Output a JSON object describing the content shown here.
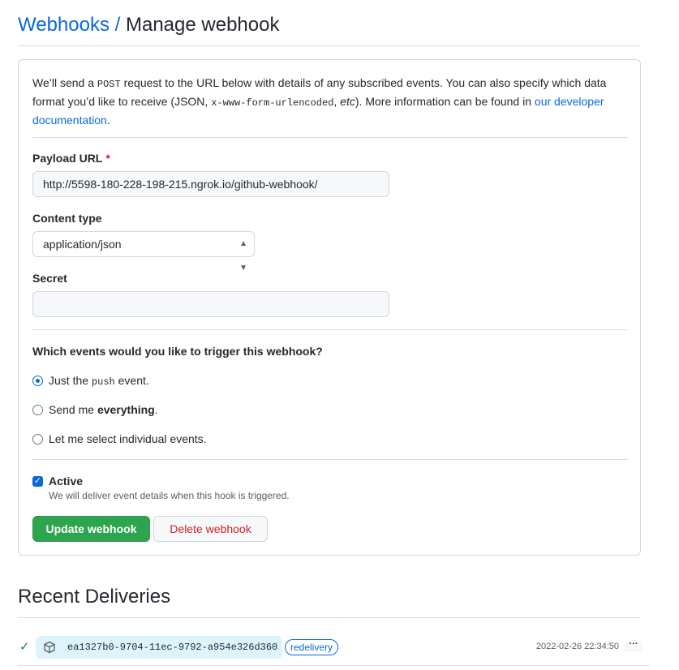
{
  "header": {
    "breadcrumb_parent": "Webhooks",
    "separator": " / ",
    "title": "Manage webhook"
  },
  "intro": {
    "text_1": "We’ll send a ",
    "method": "POST",
    "text_2": " request to the URL below with details of any subscribed events. You can also specify which data format you’d like to receive (JSON, ",
    "format_code": "x-www-form-urlencoded",
    "text_3": ", ",
    "etc": "etc",
    "text_4": "). More information can be found in ",
    "link": "our developer documentation",
    "text_5": "."
  },
  "form": {
    "payload_url_label": "Payload URL",
    "required_mark": "*",
    "payload_url_value": "http://5598-180-228-198-215.ngrok.io/github-webhook/",
    "content_type_label": "Content type",
    "content_type_value": "application/json",
    "secret_label": "Secret",
    "secret_value": "",
    "events_question": "Which events would you like to trigger this webhook?",
    "events": [
      {
        "pre": "Just the ",
        "code": "push",
        "post": " event.",
        "checked": true
      },
      {
        "pre": "Send me ",
        "bold": "everything",
        "post": ".",
        "checked": false
      },
      {
        "pre": "Let me select individual events.",
        "checked": false
      }
    ],
    "active_label": "Active",
    "active_checked": true,
    "active_note": "We will deliver event details when this hook is triggered.",
    "update_button": "Update webhook",
    "delete_button": "Delete webhook"
  },
  "recent": {
    "title": "Recent Deliveries",
    "deliveries": [
      {
        "status_icon": "check-icon",
        "type_icon": "package-icon",
        "guid": "ea1327b0-9704-11ec-9792-a954e326d360",
        "badge": "redelivery",
        "timestamp": "2022-02-26 22:34:50",
        "menu": "···"
      }
    ]
  },
  "colors": {
    "link": "#0969da",
    "required": "#cf222e",
    "primary_button": "#2da44e",
    "danger_text": "#cf222e",
    "success": "#1a7f37",
    "guid_bg": "#ddf4ff"
  }
}
